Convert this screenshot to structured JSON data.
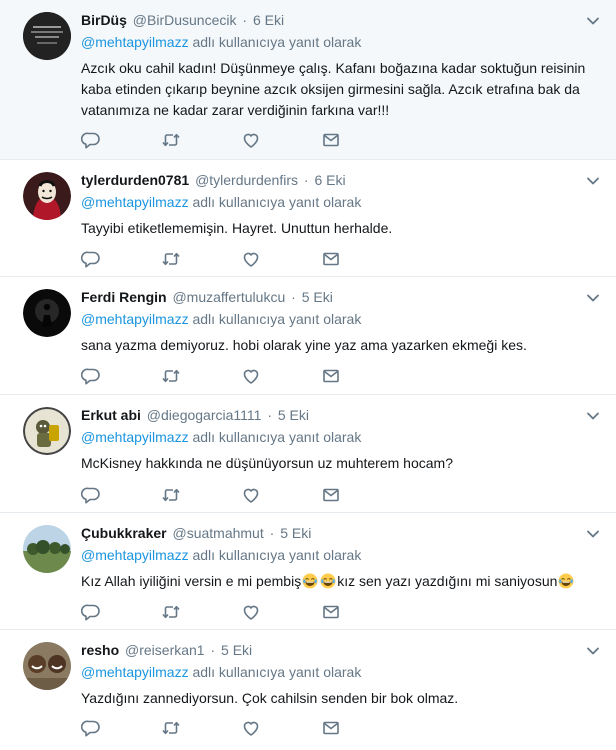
{
  "reply_prefix_mention": "@mehtapyilmazz",
  "reply_suffix": "adlı kullanıcıya yanıt olarak",
  "tweets": [
    {
      "name": "BirDüş",
      "handle": "@BirDusuncecik",
      "date": "6 Eki",
      "text": "Azcık oku cahil kadın! Düşünmeye çalış. Kafanı boğazına kadar soktuğun reisinin kaba etinden çıkarıp beynine azcık oksijen girmesini sağla. Azcık etrafına bak da vatanımıza ne kadar zarar verdiğinin farkına var!!!"
    },
    {
      "name": "tylerdurden0781",
      "handle": "@tylerdurdenfirs",
      "date": "6 Eki",
      "text": "Tayyibi etiketlememişin. Hayret. Unuttun herhalde."
    },
    {
      "name": "Ferdi Rengin",
      "handle": "@muzaffertulukcu",
      "date": "5 Eki",
      "text": "sana yazma demiyoruz. hobi olarak yine yaz ama yazarken ekmeği kes."
    },
    {
      "name": "Erkut abi",
      "handle": "@diegogarcia1111",
      "date": "5 Eki",
      "text": "McKisney hakkında ne düşünüyorsun uz muhterem hocam?"
    },
    {
      "name": "Çubukkraker",
      "handle": "@suatmahmut",
      "date": "5 Eki",
      "text_a": "Kız Allah iyiliğini versin e mi pembiş",
      "text_b": "kız sen yazı yazdığını mi saniyosun"
    },
    {
      "name": "resho",
      "handle": "@reiserkan1",
      "date": "5 Eki",
      "text": "Yazdığını zannediyorsun. Çok cahilsin senden bir bok olmaz."
    }
  ],
  "icons": {
    "reply": "reply-icon",
    "retweet": "retweet-icon",
    "like": "heart-icon",
    "dm": "envelope-icon",
    "more": "chevron-down-icon"
  },
  "colors": {
    "link": "#1b95e0",
    "muted": "#657786",
    "highlight_bg": "#f5f8fa"
  }
}
